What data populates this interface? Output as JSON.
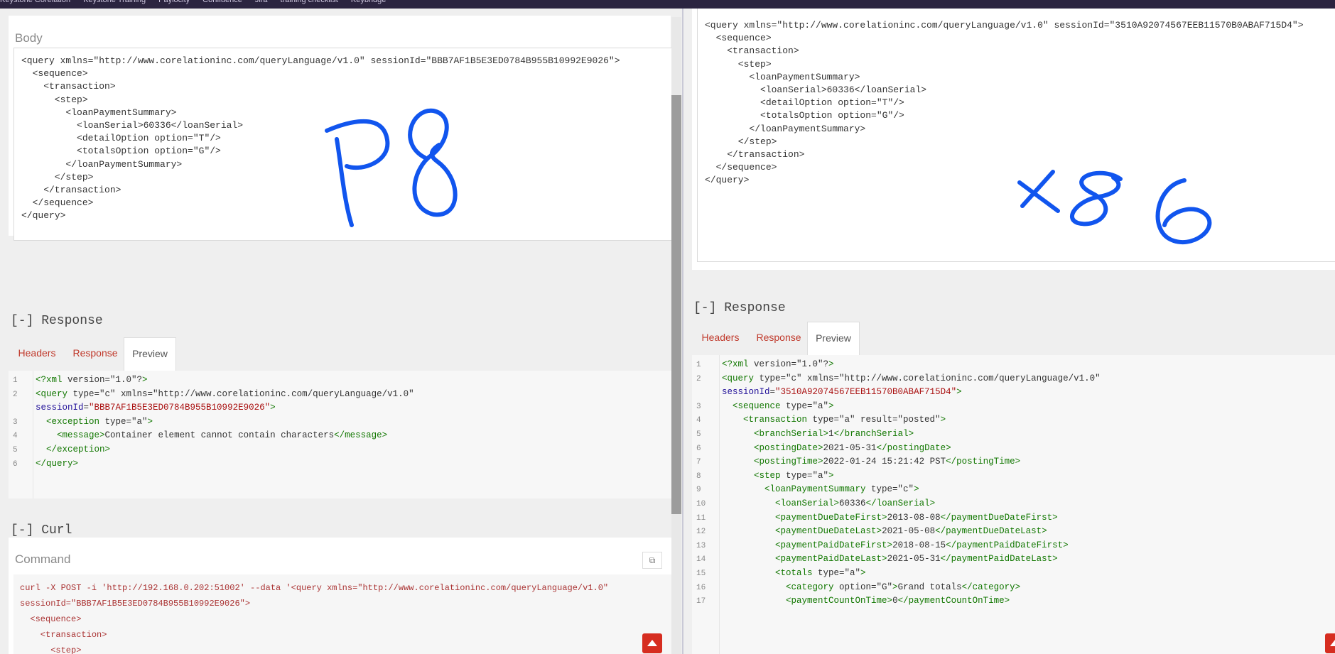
{
  "bookmarks": [
    "Keystone Corelation",
    "Keystone Training",
    "Paylocity",
    "Confluence",
    "Jira",
    "training checklist",
    "Keybridge"
  ],
  "left": {
    "body_label": "Body",
    "body_lines": [
      "<query xmlns=\"http://www.corelationinc.com/queryLanguage/v1.0\" sessionId=\"BBB7AF1B5E3ED0784B955B10992E9026\">",
      "  <sequence>",
      "    <transaction>",
      "      <step>",
      "        <loanPaymentSummary>",
      "          <loanSerial>60336</loanSerial>",
      "          <detailOption option=\"T\"/>",
      "          <totalsOption option=\"G\"/>",
      "        </loanPaymentSummary>",
      "      </step>",
      "    </transaction>",
      "  </sequence>",
      "</query>"
    ],
    "handwriting": "P8",
    "response_title": "[-] Response",
    "tabs": [
      "Headers",
      "Response",
      "Preview"
    ],
    "response_lines": [
      {
        "n": "1",
        "t": "<?xml version=\"1.0\"?>"
      },
      {
        "n": "2",
        "t": "<query type=\"c\" xmlns=\"http://www.corelationinc.com/queryLanguage/v1.0\""
      },
      {
        "n": "",
        "t": "sessionId=\"BBB7AF1B5E3ED0784B955B10992E9026\">"
      },
      {
        "n": "3",
        "t": "  <exception type=\"a\">"
      },
      {
        "n": "4",
        "t": "    <message>Container element cannot contain characters</message>"
      },
      {
        "n": "5",
        "t": "  </exception>"
      },
      {
        "n": "6",
        "t": "</query>"
      }
    ],
    "curl_title": "[-] Curl",
    "command_label": "Command",
    "curl_lines": [
      "curl -X POST -i 'http://192.168.0.202:51002' --data '<query xmlns=\"http://www.corelationinc.com/queryLanguage/v1.0\"",
      "sessionId=\"BBB7AF1B5E3ED0784B955B10992E9026\">",
      "  <sequence>",
      "    <transaction>",
      "      <step>"
    ]
  },
  "right": {
    "body_lines": [
      "<query xmlns=\"http://www.corelationinc.com/queryLanguage/v1.0\" sessionId=\"3510A92074567EEB11570B0ABAF715D4\">",
      "  <sequence>",
      "    <transaction>",
      "      <step>",
      "        <loanPaymentSummary>",
      "          <loanSerial>60336</loanSerial>",
      "          <detailOption option=\"T\"/>",
      "          <totalsOption option=\"G\"/>",
      "        </loanPaymentSummary>",
      "      </step>",
      "    </transaction>",
      "  </sequence>",
      "</query>"
    ],
    "handwriting": "x86",
    "response_title": "[-] Response",
    "tabs": [
      "Headers",
      "Response",
      "Preview"
    ],
    "response_lines": [
      {
        "n": "1",
        "t": "<?xml version=\"1.0\"?>"
      },
      {
        "n": "2",
        "t": "<query type=\"c\" xmlns=\"http://www.corelationinc.com/queryLanguage/v1.0\""
      },
      {
        "n": "",
        "t": "sessionId=\"3510A92074567EEB11570B0ABAF715D4\">"
      },
      {
        "n": "3",
        "t": "  <sequence type=\"a\">"
      },
      {
        "n": "4",
        "t": "    <transaction type=\"a\" result=\"posted\">"
      },
      {
        "n": "5",
        "t": "      <branchSerial>1</branchSerial>"
      },
      {
        "n": "6",
        "t": "      <postingDate>2021-05-31</postingDate>"
      },
      {
        "n": "7",
        "t": "      <postingTime>2022-01-24 15:21:42 PST</postingTime>"
      },
      {
        "n": "8",
        "t": "      <step type=\"a\">"
      },
      {
        "n": "9",
        "t": "        <loanPaymentSummary type=\"c\">"
      },
      {
        "n": "10",
        "t": "          <loanSerial>60336</loanSerial>"
      },
      {
        "n": "11",
        "t": "          <paymentDueDateFirst>2013-08-08</paymentDueDateFirst>"
      },
      {
        "n": "12",
        "t": "          <paymentDueDateLast>2021-05-08</paymentDueDateLast>"
      },
      {
        "n": "13",
        "t": "          <paymentPaidDateFirst>2018-08-15</paymentPaidDateFirst>"
      },
      {
        "n": "14",
        "t": "          <paymentPaidDateLast>2021-05-31</paymentPaidDateLast>"
      },
      {
        "n": "15",
        "t": "          <totals type=\"a\">"
      },
      {
        "n": "16",
        "t": "            <category option=\"G\">Grand totals</category>"
      },
      {
        "n": "17",
        "t": "            <paymentCountOnTime>0</paymentCountOnTime>"
      }
    ]
  }
}
